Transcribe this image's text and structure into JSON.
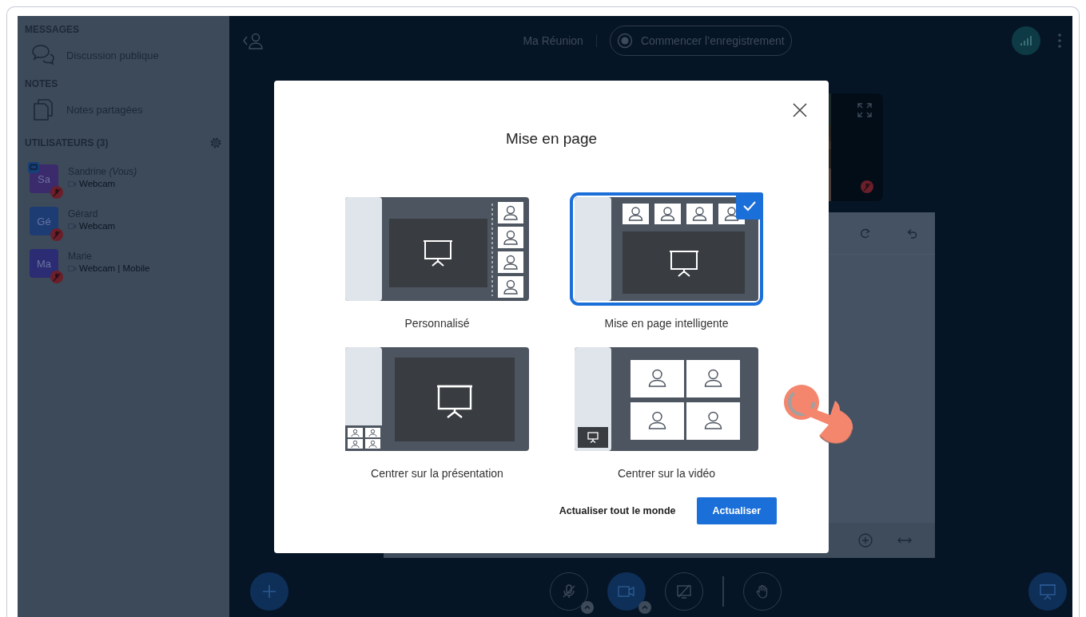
{
  "sidebar": {
    "sections": [
      {
        "title": "MESSAGES",
        "items": [
          {
            "kind": "chat",
            "label": "Discussion publique"
          }
        ]
      },
      {
        "title": "NOTES",
        "items": [
          {
            "kind": "notes",
            "label": "Notes partagées"
          }
        ]
      }
    ],
    "users_title": "UTILISATEURS (3)",
    "users": [
      {
        "initials": "Sa",
        "name": "Sandrine *(Vous)*",
        "status": "Webcam",
        "color": "#3b2a6c",
        "presenter": true
      },
      {
        "initials": "Gé",
        "name": "Gérard",
        "status": "Webcam",
        "color": "#1d3c74",
        "presenter": false
      },
      {
        "initials": "Ma",
        "name": "Marie",
        "status": "Webcam | Mobile",
        "color": "#2c2c74",
        "presenter": false
      }
    ]
  },
  "topbar": {
    "title": "Ma Réunion",
    "record_label": "Commencer l’enregistrement"
  },
  "dialog": {
    "title": "Mise en page",
    "options": [
      {
        "kind": "custom",
        "label": "Personnalisé",
        "selected": false
      },
      {
        "kind": "smart",
        "label": "Mise en page intelligente",
        "selected": true
      },
      {
        "kind": "presentation",
        "label": "Centrer sur la présentation",
        "selected": false
      },
      {
        "kind": "video",
        "label": "Centrer sur la vidéo",
        "selected": false
      }
    ],
    "secondary_button": "Actualiser tout le monde",
    "primary_button": "Actualiser"
  }
}
